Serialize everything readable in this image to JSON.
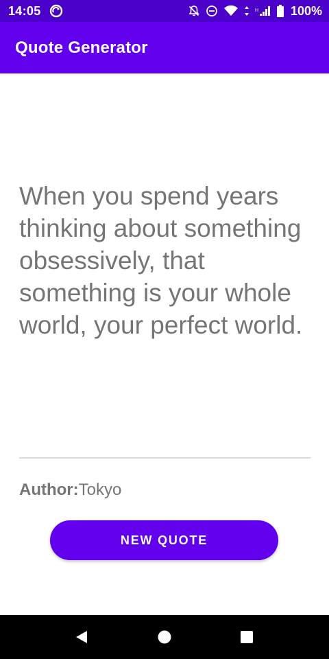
{
  "status_bar": {
    "time": "14:05",
    "battery": "100%",
    "icons": [
      "sync-icon",
      "bell-off-icon",
      "do-not-disturb-icon",
      "wifi-icon",
      "signal-icon",
      "battery-icon"
    ]
  },
  "app_bar": {
    "title": "Quote Generator"
  },
  "quote": {
    "text": "When you spend years thinking about something obsessively, that something is your whole world, your perfect world."
  },
  "author": {
    "label": "Author:",
    "name": "Tokyo"
  },
  "new_quote_button": {
    "label": "NEW QUOTE"
  },
  "nav_bar": {
    "icons": [
      "back-icon",
      "home-icon",
      "recents-icon"
    ]
  },
  "colors": {
    "status_bar": "#4a00c9",
    "primary": "#6200ee",
    "quote_text": "#757575",
    "divider": "#d9d9d9",
    "nav_bar": "#000000"
  }
}
